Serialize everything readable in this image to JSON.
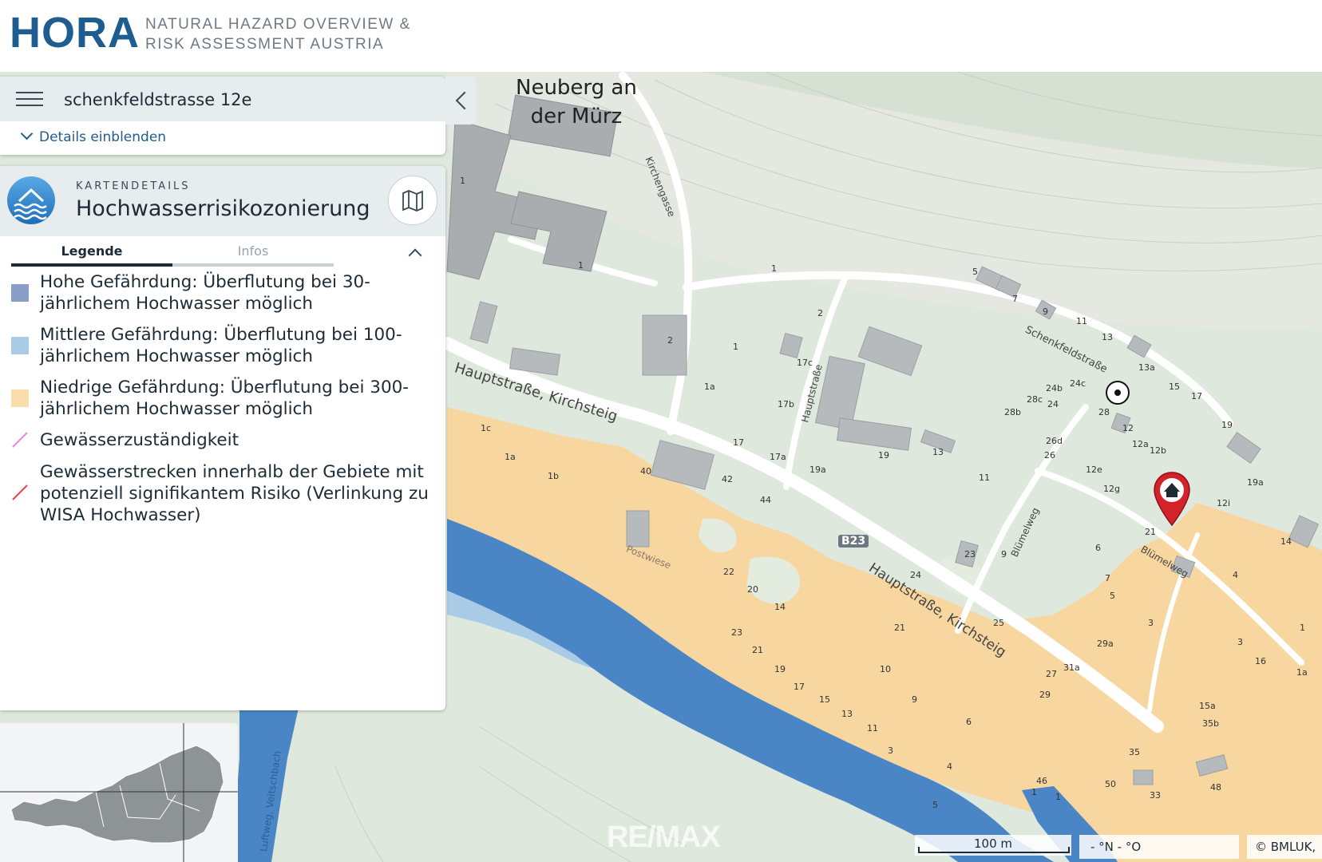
{
  "header": {
    "logo_text": "HORA",
    "subtitle_line1": "NATURAL HAZARD OVERVIEW &",
    "subtitle_line2": "RISK ASSESSMENT AUSTRIA"
  },
  "search": {
    "value": "schenkfeldstrasse 12e",
    "details_label": "Details einblenden"
  },
  "details": {
    "section_label": "KARTENDETAILS",
    "title": "Hochwasserrisikozonierung",
    "tabs": [
      "Legende",
      "Infos"
    ],
    "active_tab": "Legende"
  },
  "legend": {
    "items": [
      {
        "label": "Hohe Gefährdung: Überflutung bei 30-jährlichem Hochwasser möglich",
        "color": "#8a9fc7"
      },
      {
        "label": "Mittlere Gefährdung: Überflutung bei 100-jährlichem Hochwasser möglich",
        "color": "#a9cbe6"
      },
      {
        "label": "Niedrige Gefährdung: Überflutung bei 300-jährlichem Hochwasser möglich",
        "color": "#fbdcab"
      },
      {
        "label": "Gewässerzuständigkeit",
        "color": "#e58ae0"
      },
      {
        "label": "Gewässerstrecken innerhalb der Gebiete mit potenziell signifikantem Risiko (Verlinkung zu WISA Hochwasser)",
        "color": "#e8454a"
      }
    ]
  },
  "map": {
    "place_label_line1": "Neuberg an",
    "place_label_line2": "der Mürz",
    "streets": {
      "hauptstrasse_1": "Hauptstraße, Kirchsteig",
      "hauptstrasse_2": "Hauptstraße, Kirchsteig",
      "schenkfeldstrasse": "Schenkfeldstraße",
      "kirchengasse": "Kirchengasse",
      "hauptstrasse_short": "Hauptstraße",
      "bluemelweg_1": "Blümelweg",
      "bluemelweg_2": "Blümelweg",
      "postwiese": "Postwiese",
      "veitschbach": "Luftweg, Veitschbach"
    },
    "road_shield": "B23",
    "house_numbers": [
      "1",
      "1",
      "1",
      "2",
      "2",
      "1",
      "1a",
      "17c",
      "17b",
      "17",
      "17a",
      "19a",
      "19",
      "13",
      "11",
      "42",
      "44",
      "40",
      "1a",
      "1b",
      "1c",
      "5",
      "7",
      "9",
      "11",
      "13",
      "13a",
      "15",
      "17",
      "19",
      "19a",
      "24c",
      "24b",
      "24",
      "28c",
      "28b",
      "26d",
      "26",
      "28",
      "12",
      "12b",
      "12a",
      "12e",
      "12g",
      "12i",
      "14",
      "21",
      "6",
      "7",
      "5",
      "3",
      "9",
      "23",
      "25",
      "29a",
      "31a",
      "27",
      "29",
      "24",
      "21",
      "22",
      "20",
      "14",
      "23",
      "21",
      "19",
      "17",
      "15",
      "13",
      "11",
      "10",
      "9",
      "6",
      "4",
      "3",
      "5",
      "1",
      "1",
      "4",
      "3",
      "16",
      "1a",
      "1",
      "15a",
      "35b",
      "35",
      "33",
      "48",
      "50",
      "46",
      "1"
    ],
    "flood_colors": {
      "high": "#4a86c6",
      "medium": "#a9cbe6",
      "low": "#f8d6a0"
    },
    "scale_label": "100 m",
    "coordinates": "- °N  - °O",
    "attribution": "© BMLUK,",
    "watermark": "RE/MAX"
  }
}
